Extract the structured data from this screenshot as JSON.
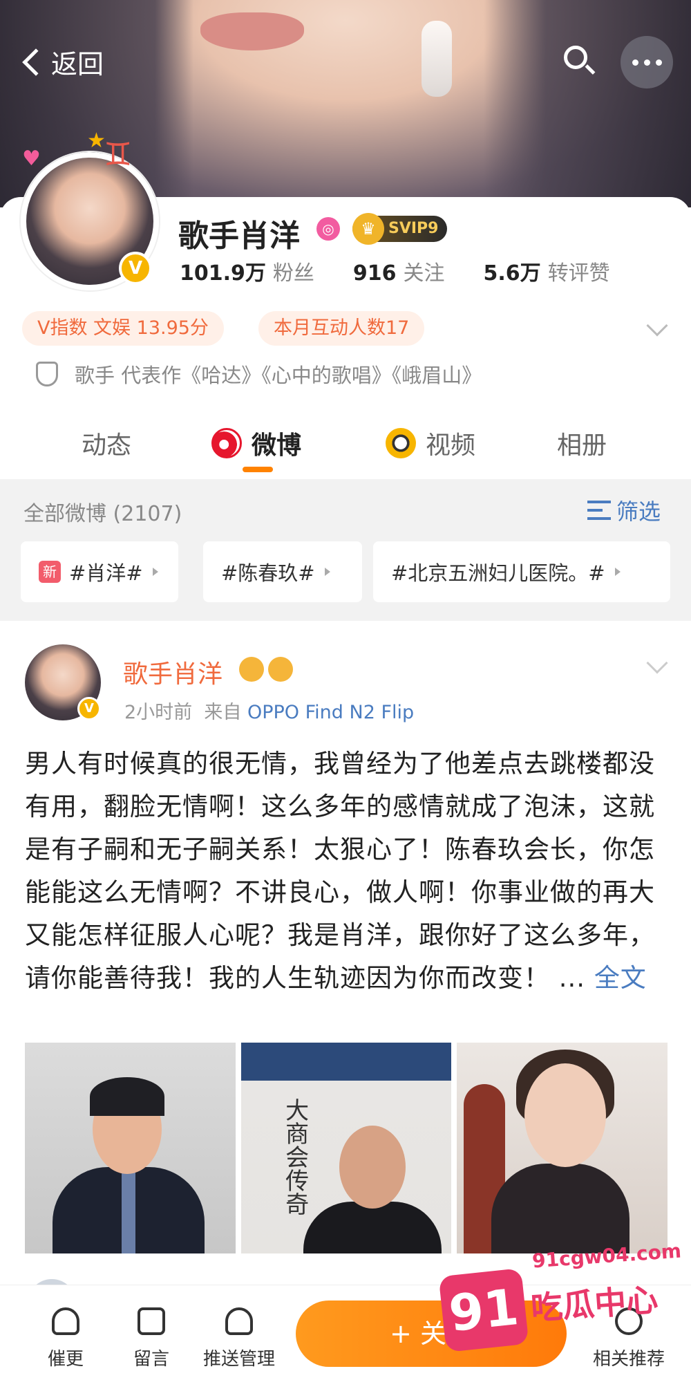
{
  "topbar": {
    "back_label": "返回"
  },
  "profile": {
    "name": "歌手肖洋",
    "svip_label": "SVIP9",
    "stats": [
      {
        "value": "101.9万",
        "label": "粉丝"
      },
      {
        "value": "916",
        "label": "关注"
      },
      {
        "value": "5.6万",
        "label": "转评赞"
      }
    ],
    "pills": {
      "v_index": "V指数 文娱 13.95分",
      "monthly": "本月互动人数17"
    },
    "intro": "歌手 代表作《哈达》《心中的歌唱》《峨眉山》"
  },
  "tabs": [
    {
      "label": "动态",
      "icon": "none"
    },
    {
      "label": "微博",
      "icon": "weibo-icon",
      "active": true
    },
    {
      "label": "视频",
      "icon": "video-icon"
    },
    {
      "label": "相册",
      "icon": "none"
    }
  ],
  "filter": {
    "all_label": "全部微博 (2107)",
    "filter_label": "筛选",
    "chips": [
      {
        "label": "#肖洋#",
        "badge": "新"
      },
      {
        "label": "#陈春玖#"
      },
      {
        "label": "#北京五洲妇儿医院。#"
      }
    ]
  },
  "post": {
    "author": "歌手肖洋",
    "time": "2小时前",
    "source_prefix": "来自",
    "source": "OPPO Find N2 Flip",
    "text": "男人有时候真的很无情，我曾经为了他差点去跳楼都没有用，翻脸无情啊！这么多年的感情就成了泡沫，这就是有子嗣和无子嗣关系！太狠心了！陈春玖会长，你怎能能这么无情啊？不讲良心，做人啊！你事业做的再大又能怎样征服人心呢？我是肖洋，跟你好了这么多年，请你能善待我！我的人生轨迹因为你而改变！ ... ",
    "more_label": "全文",
    "book_title": "大商会传奇"
  },
  "bottom_nav": {
    "items": [
      {
        "label": "催更"
      },
      {
        "label": "留言"
      },
      {
        "label": "推送管理"
      }
    ],
    "follow_label": "+ 关注",
    "related_label": "相关推荐"
  },
  "watermark": {
    "number": "91",
    "url": "91cgw04.com",
    "text": "吃瓜中心"
  },
  "colors": {
    "accent": "#ff8200",
    "link": "#4a7cc0",
    "author": "#f06a3d"
  }
}
